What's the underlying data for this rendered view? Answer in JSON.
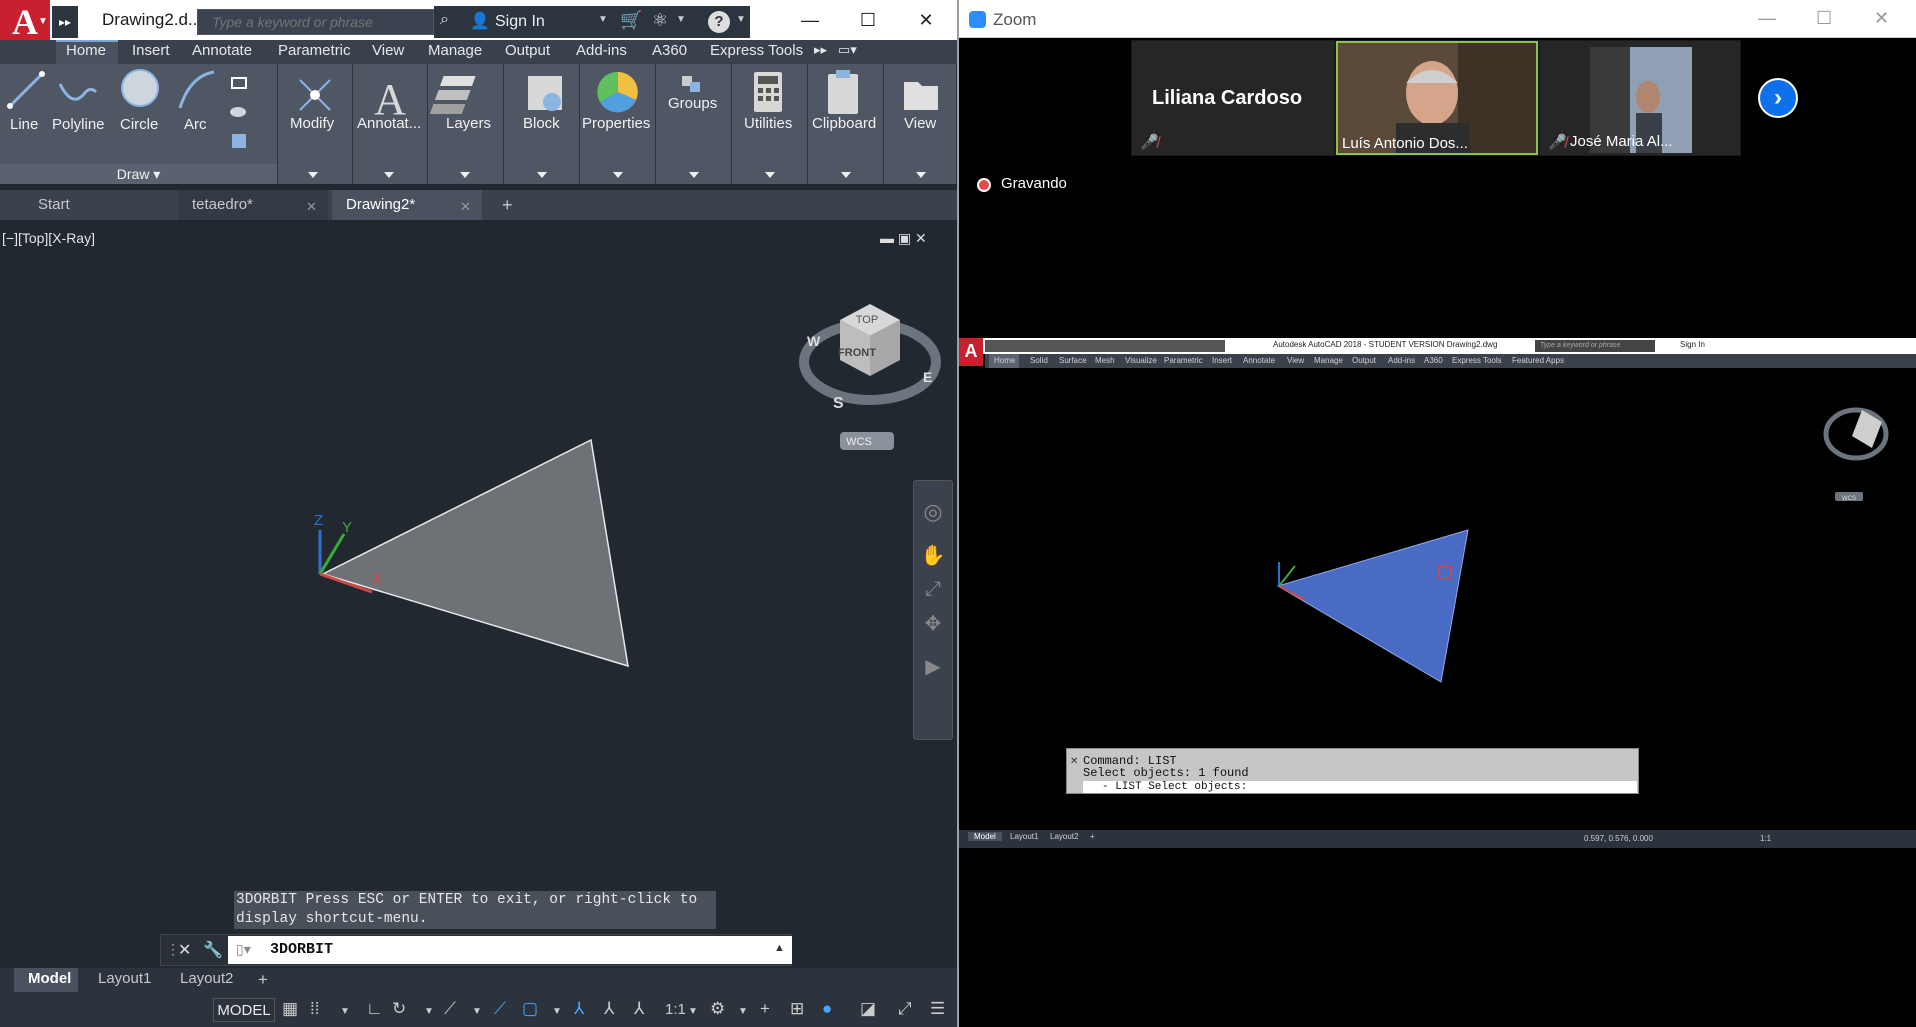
{
  "acad": {
    "title": "Drawing2.d...",
    "search_placeholder": "Type a keyword or phrase",
    "sign_in": "Sign In",
    "help_icon": "?",
    "ribbon_tabs": [
      "Home",
      "Insert",
      "Annotate",
      "Parametric",
      "View",
      "Manage",
      "Output",
      "Add-ins",
      "A360",
      "Express Tools"
    ],
    "draw_tools": [
      "Line",
      "Polyline",
      "Circle",
      "Arc"
    ],
    "draw_panel_label": "Draw",
    "panels": [
      "Modify",
      "Annotat...",
      "Layers",
      "Block",
      "Properties",
      "Groups",
      "Utilities",
      "Clipboard",
      "View"
    ],
    "doc_tabs": [
      "Start",
      "tetaedro*",
      "Drawing2*"
    ],
    "viewport_label": "[−][Top][X-Ray]",
    "viewcube": {
      "top": "TOP",
      "front": "FRONT",
      "left": "W",
      "south": "S",
      "east": "E",
      "wcs": "WCS"
    },
    "ucs_labels": {
      "z": "Z",
      "y": "Y",
      "x": "X"
    },
    "command_hint_1": "3DORBIT Press ESC or ENTER to exit, or right-click to",
    "command_hint_2": "display shortcut-menu.",
    "command_input": "3DORBIT",
    "layout_tabs": [
      "Model",
      "Layout1",
      "Layout2"
    ],
    "status_model": "MODEL",
    "status_scale": "1:1"
  },
  "zoom": {
    "app_name": "Zoom",
    "participants": [
      {
        "name": "Liliana Cardoso",
        "muted": true
      },
      {
        "name": "Luís Antonio Dos...",
        "muted": false
      },
      {
        "name": "José Maria Al...",
        "muted": true
      }
    ],
    "recording_label": "Gravando",
    "shared": {
      "app_title": "Autodesk AutoCAD 2018 - STUDENT VERSION    Drawing2.dwg",
      "search_placeholder": "Type a keyword or phrase",
      "sign_in": "Sign In",
      "tabs": [
        "Home",
        "Solid",
        "Surface",
        "Mesh",
        "Visualize",
        "Parametric",
        "Insert",
        "Annotate",
        "View",
        "Manage",
        "Output",
        "Add-ins",
        "A360",
        "Express Tools",
        "Featured Apps"
      ],
      "cmd_line_1": "Command: LIST",
      "cmd_line_2": "Select objects: 1 found",
      "cmd_input": "- LIST Select objects:",
      "layout_tabs": [
        "Model",
        "Layout1",
        "Layout2"
      ],
      "coords": "0.597, 0.576, 0.000",
      "scale": "1:1",
      "wcs": "WCS"
    }
  },
  "colors": {
    "acad_bg": "#212830",
    "triangle_fill": "#6e7175",
    "shared_triangle": "#4a6bc4",
    "zoom_blue": "#0e71eb",
    "record_red": "#e64b4b"
  }
}
